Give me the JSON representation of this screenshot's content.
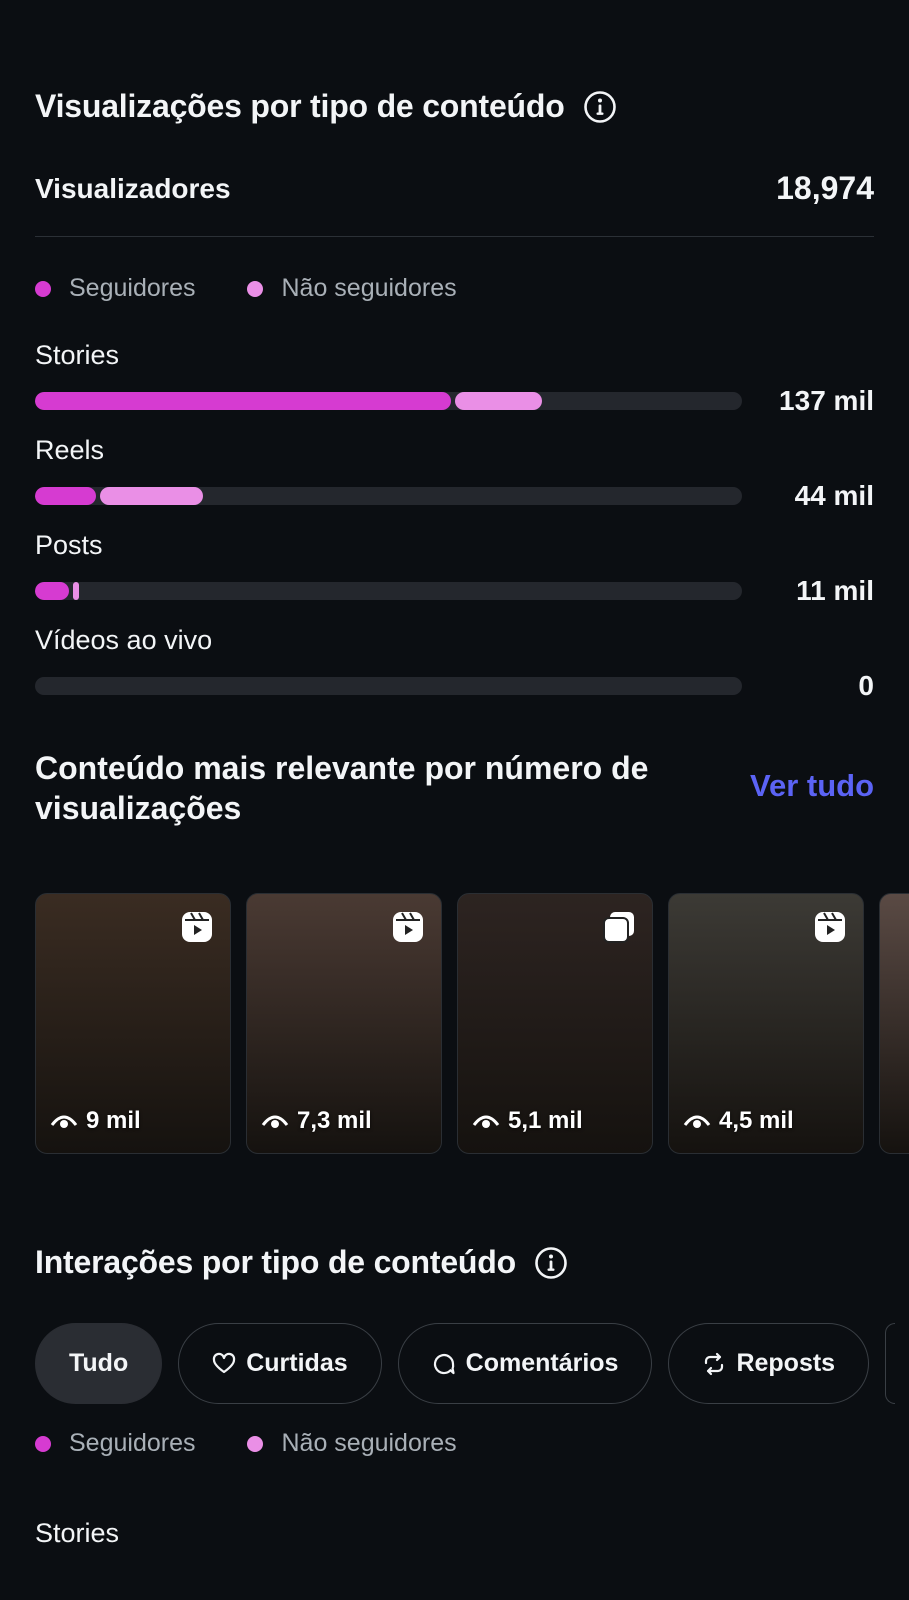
{
  "views_section": {
    "title": "Visualizações por tipo de conteúdo",
    "viewers_label": "Visualizadores",
    "viewers_value": "18,974",
    "legend": [
      {
        "label": "Seguidores",
        "color": "#d63bd1"
      },
      {
        "label": "Não seguidores",
        "color": "#ea8fe6"
      }
    ],
    "bars": [
      {
        "label": "Stories",
        "value": "137 mil",
        "followers_fraction": 0.588,
        "nonfollowers_fraction": 0.123
      },
      {
        "label": "Reels",
        "value": "44 mil",
        "followers_fraction": 0.086,
        "nonfollowers_fraction": 0.145
      },
      {
        "label": "Posts",
        "value": "11 mil",
        "followers_fraction": 0.048,
        "nonfollowers_fraction": 0.008
      },
      {
        "label": "Vídeos ao vivo",
        "value": "0",
        "followers_fraction": 0,
        "nonfollowers_fraction": 0
      }
    ]
  },
  "relevant_section": {
    "title": "Conteúdo mais relevante por número de visualizações",
    "see_all": "Ver tudo",
    "items": [
      {
        "views": "9 mil",
        "icon": "reel-icon",
        "bg": "#3a2c22"
      },
      {
        "views": "7,3 mil",
        "icon": "reel-icon",
        "bg": "#4a3a33"
      },
      {
        "views": "5,1 mil",
        "icon": "carousel-icon",
        "bg": "#2d2421"
      },
      {
        "views": "4,5 mil",
        "icon": "reel-icon",
        "bg": "#3c3a35"
      },
      {
        "views": "",
        "icon": "",
        "bg": "#5a4a44"
      }
    ]
  },
  "interactions_section": {
    "title": "Interações por tipo de conteúdo",
    "chips": [
      {
        "label": "Tudo",
        "icon": "",
        "active": true
      },
      {
        "label": "Curtidas",
        "icon": "heart-icon",
        "active": false
      },
      {
        "label": "Comentários",
        "icon": "comment-icon",
        "active": false
      },
      {
        "label": "Reposts",
        "icon": "repost-icon",
        "active": false
      }
    ],
    "legend": [
      {
        "label": "Seguidores",
        "color": "#d63bd1"
      },
      {
        "label": "Não seguidores",
        "color": "#ea8fe6"
      }
    ],
    "first_row_label": "Stories"
  }
}
